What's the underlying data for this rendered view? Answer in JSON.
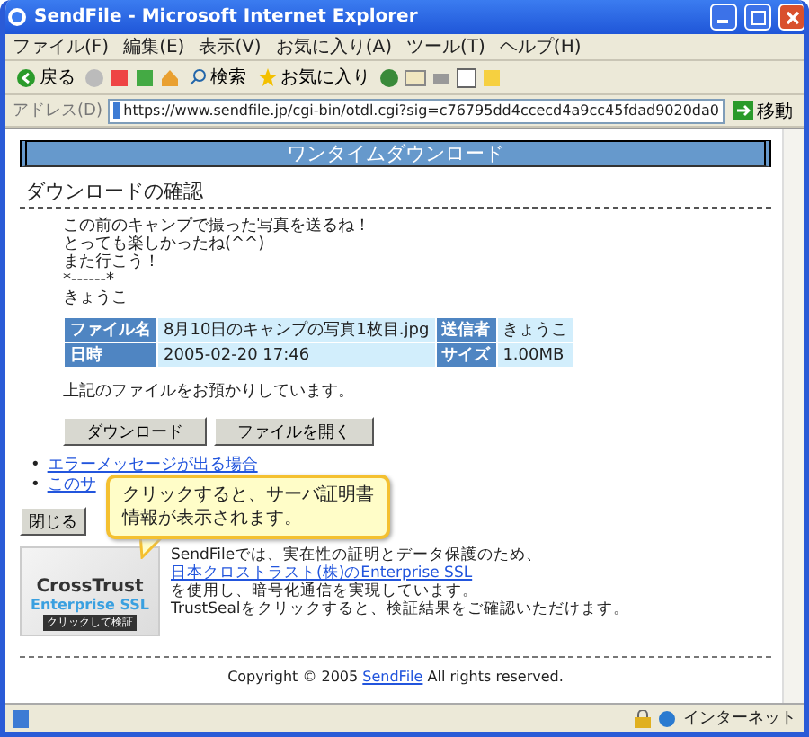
{
  "window": {
    "title": "SendFile - Microsoft Internet Explorer"
  },
  "menu": [
    "ファイル(F)",
    "編集(E)",
    "表示(V)",
    "お気に入り(A)",
    "ツール(T)",
    "ヘルプ(H)"
  ],
  "toolbar": {
    "back": "戻る",
    "search": "検索",
    "favorites": "お気に入り"
  },
  "address": {
    "label": "アドレス(D)",
    "value": "https://www.sendfile.jp/cgi-bin/otdl.cgi?sig=c76795dd4ccecd4a9cc45fdad9020da0",
    "go": "移動"
  },
  "page": {
    "banner": "ワンタイムダウンロード",
    "heading": "ダウンロードの確認",
    "message": [
      "この前のキャンプで撮った写真を送るね！",
      "とっても楽しかったね(^^)",
      "また行こう！",
      "*------*",
      "きょうこ"
    ],
    "table": [
      [
        "ファイル名",
        "8月10日のキャンプの写真1枚目.jpg",
        "送信者",
        "きょうこ"
      ],
      [
        "日時",
        "2005-02-20 17:46",
        "サイズ",
        "1.00MB"
      ]
    ],
    "notice": "上記のファイルをお預かりしています。",
    "buttons": [
      "ダウンロード",
      "ファイルを開く"
    ],
    "bullet": "•",
    "links": [
      "エラーメッセージが出る場合",
      "このサ"
    ],
    "close": "閉じる",
    "seal": {
      "brand": "CrossTrust",
      "product": "Enterprise SSL",
      "verify": "クリックして検証"
    },
    "seal_text": {
      "before": "SendFileでは、実在性の証明とデータ保護のため、",
      "link": "日本クロストラスト(株)のEnterprise SSL",
      "after": [
        "を使用し、暗号化通信を実現しています。",
        "TrustSealをクリックすると、検証結果をご確認いただけます。"
      ]
    },
    "footer": {
      "before": "Copyright © 2005",
      "link": "SendFile",
      "after": "All rights reserved."
    }
  },
  "callout": {
    "lines": [
      "クリックすると、サーバ証明書",
      "情報が表示されます。"
    ]
  },
  "status_bar": {
    "zone": "インターネット"
  }
}
